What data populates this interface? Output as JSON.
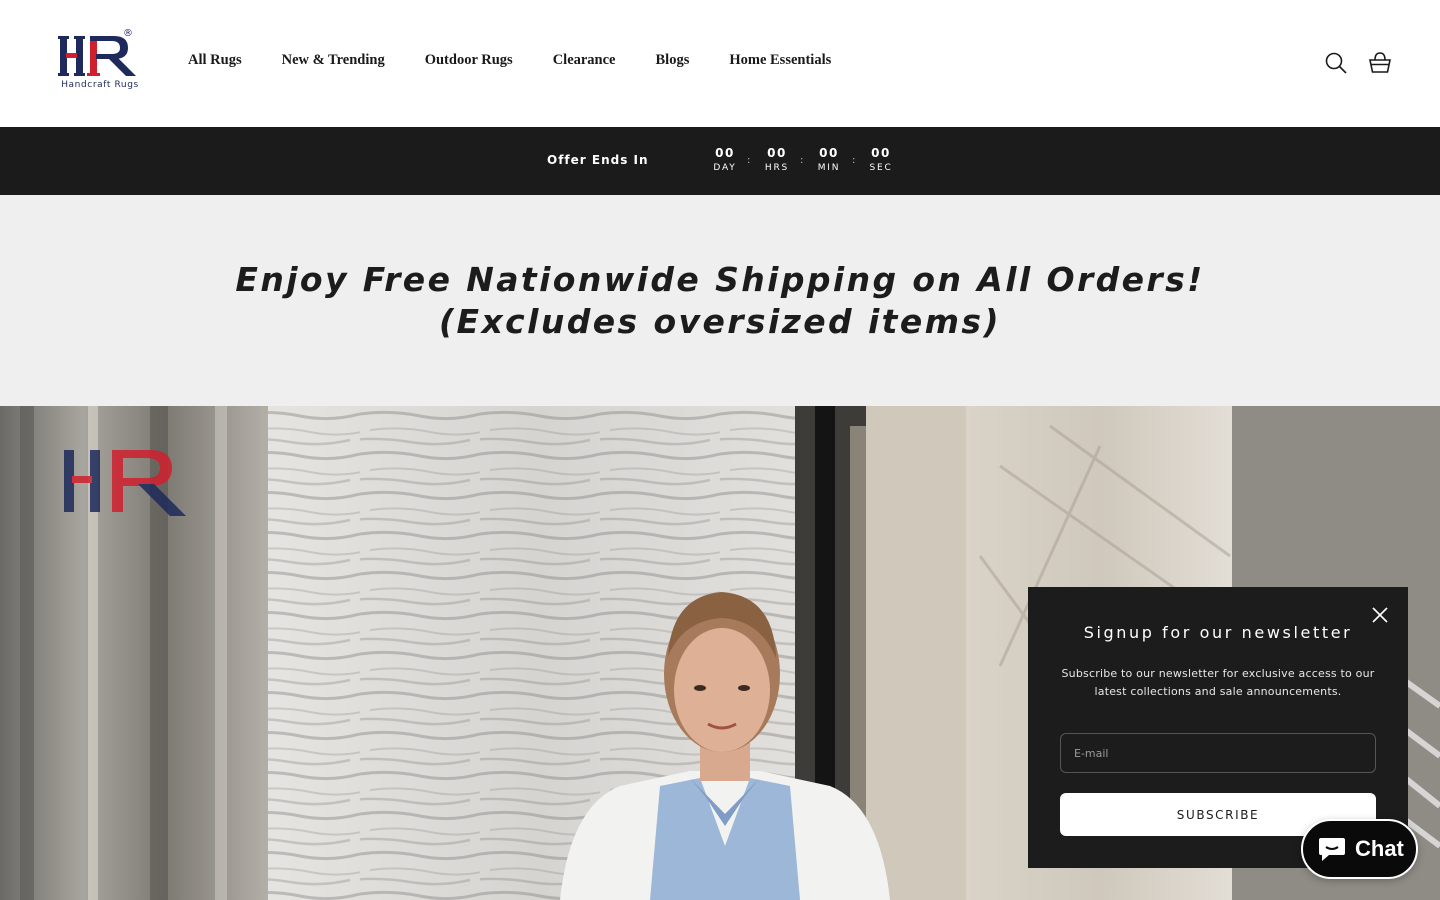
{
  "header": {
    "logo": {
      "mark": "HR",
      "registered": "®",
      "tagline": "Handcraft Rugs"
    },
    "nav": [
      "All Rugs",
      "New & Trending",
      "Outdoor Rugs",
      "Clearance",
      "Blogs",
      "Home Essentials"
    ],
    "icons": {
      "search": "search-icon",
      "cart": "cart-icon"
    }
  },
  "countdown": {
    "label": "Offer Ends In",
    "units": [
      {
        "value": "00",
        "label": "DAY"
      },
      {
        "value": "00",
        "label": "HRS"
      },
      {
        "value": "00",
        "label": "MIN"
      },
      {
        "value": "00",
        "label": "SEC"
      }
    ],
    "separator": ":"
  },
  "banner": {
    "line1": "Enjoy Free Nationwide Shipping on All Orders!",
    "line2": "(Excludes oversized items)"
  },
  "hero": {
    "watermark": "HR"
  },
  "newsletter": {
    "title": "Signup for our newsletter",
    "text": "Subscribe to our newsletter for exclusive access to our latest collections and sale announcements.",
    "email_placeholder": "E-mail",
    "email_value": "",
    "button": "SUBSCRIBE",
    "close_icon": "close-icon"
  },
  "chat": {
    "label": "Chat",
    "icon": "chat-bubble-icon"
  },
  "colors": {
    "logo_navy": "#1d2a5b",
    "logo_red": "#d0202e",
    "bar_dark": "#1b1b1b",
    "banner_bg": "#efefef",
    "popup_bg": "#1c1c1c"
  }
}
